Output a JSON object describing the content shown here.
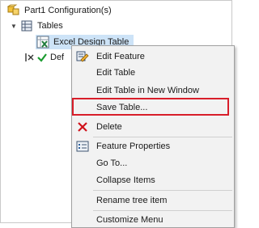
{
  "tree": {
    "part_label": "Part1 Configuration(s)",
    "tables_label": "Tables",
    "excel_label": "Excel Design Table",
    "default_label": "Def"
  },
  "menu": {
    "items": [
      {
        "label": "Edit Feature",
        "icon": "edit-feature-icon"
      },
      {
        "label": "Edit Table",
        "icon": ""
      },
      {
        "label": "Edit Table in New Window",
        "icon": ""
      },
      {
        "label": "Save Table...",
        "icon": ""
      },
      {
        "label": "Delete",
        "icon": "delete-x-icon"
      },
      {
        "label": "Feature Properties",
        "icon": "feature-properties-icon"
      },
      {
        "label": "Go To...",
        "icon": ""
      },
      {
        "label": "Collapse Items",
        "icon": ""
      },
      {
        "label": "Rename tree item",
        "icon": ""
      },
      {
        "label": "Customize Menu",
        "icon": ""
      }
    ]
  },
  "colors": {
    "highlight_border": "#d81e2a",
    "selection_bg": "#cde3f7",
    "delete_icon": "#d0121b",
    "check_icon": "#1a9b2f"
  }
}
